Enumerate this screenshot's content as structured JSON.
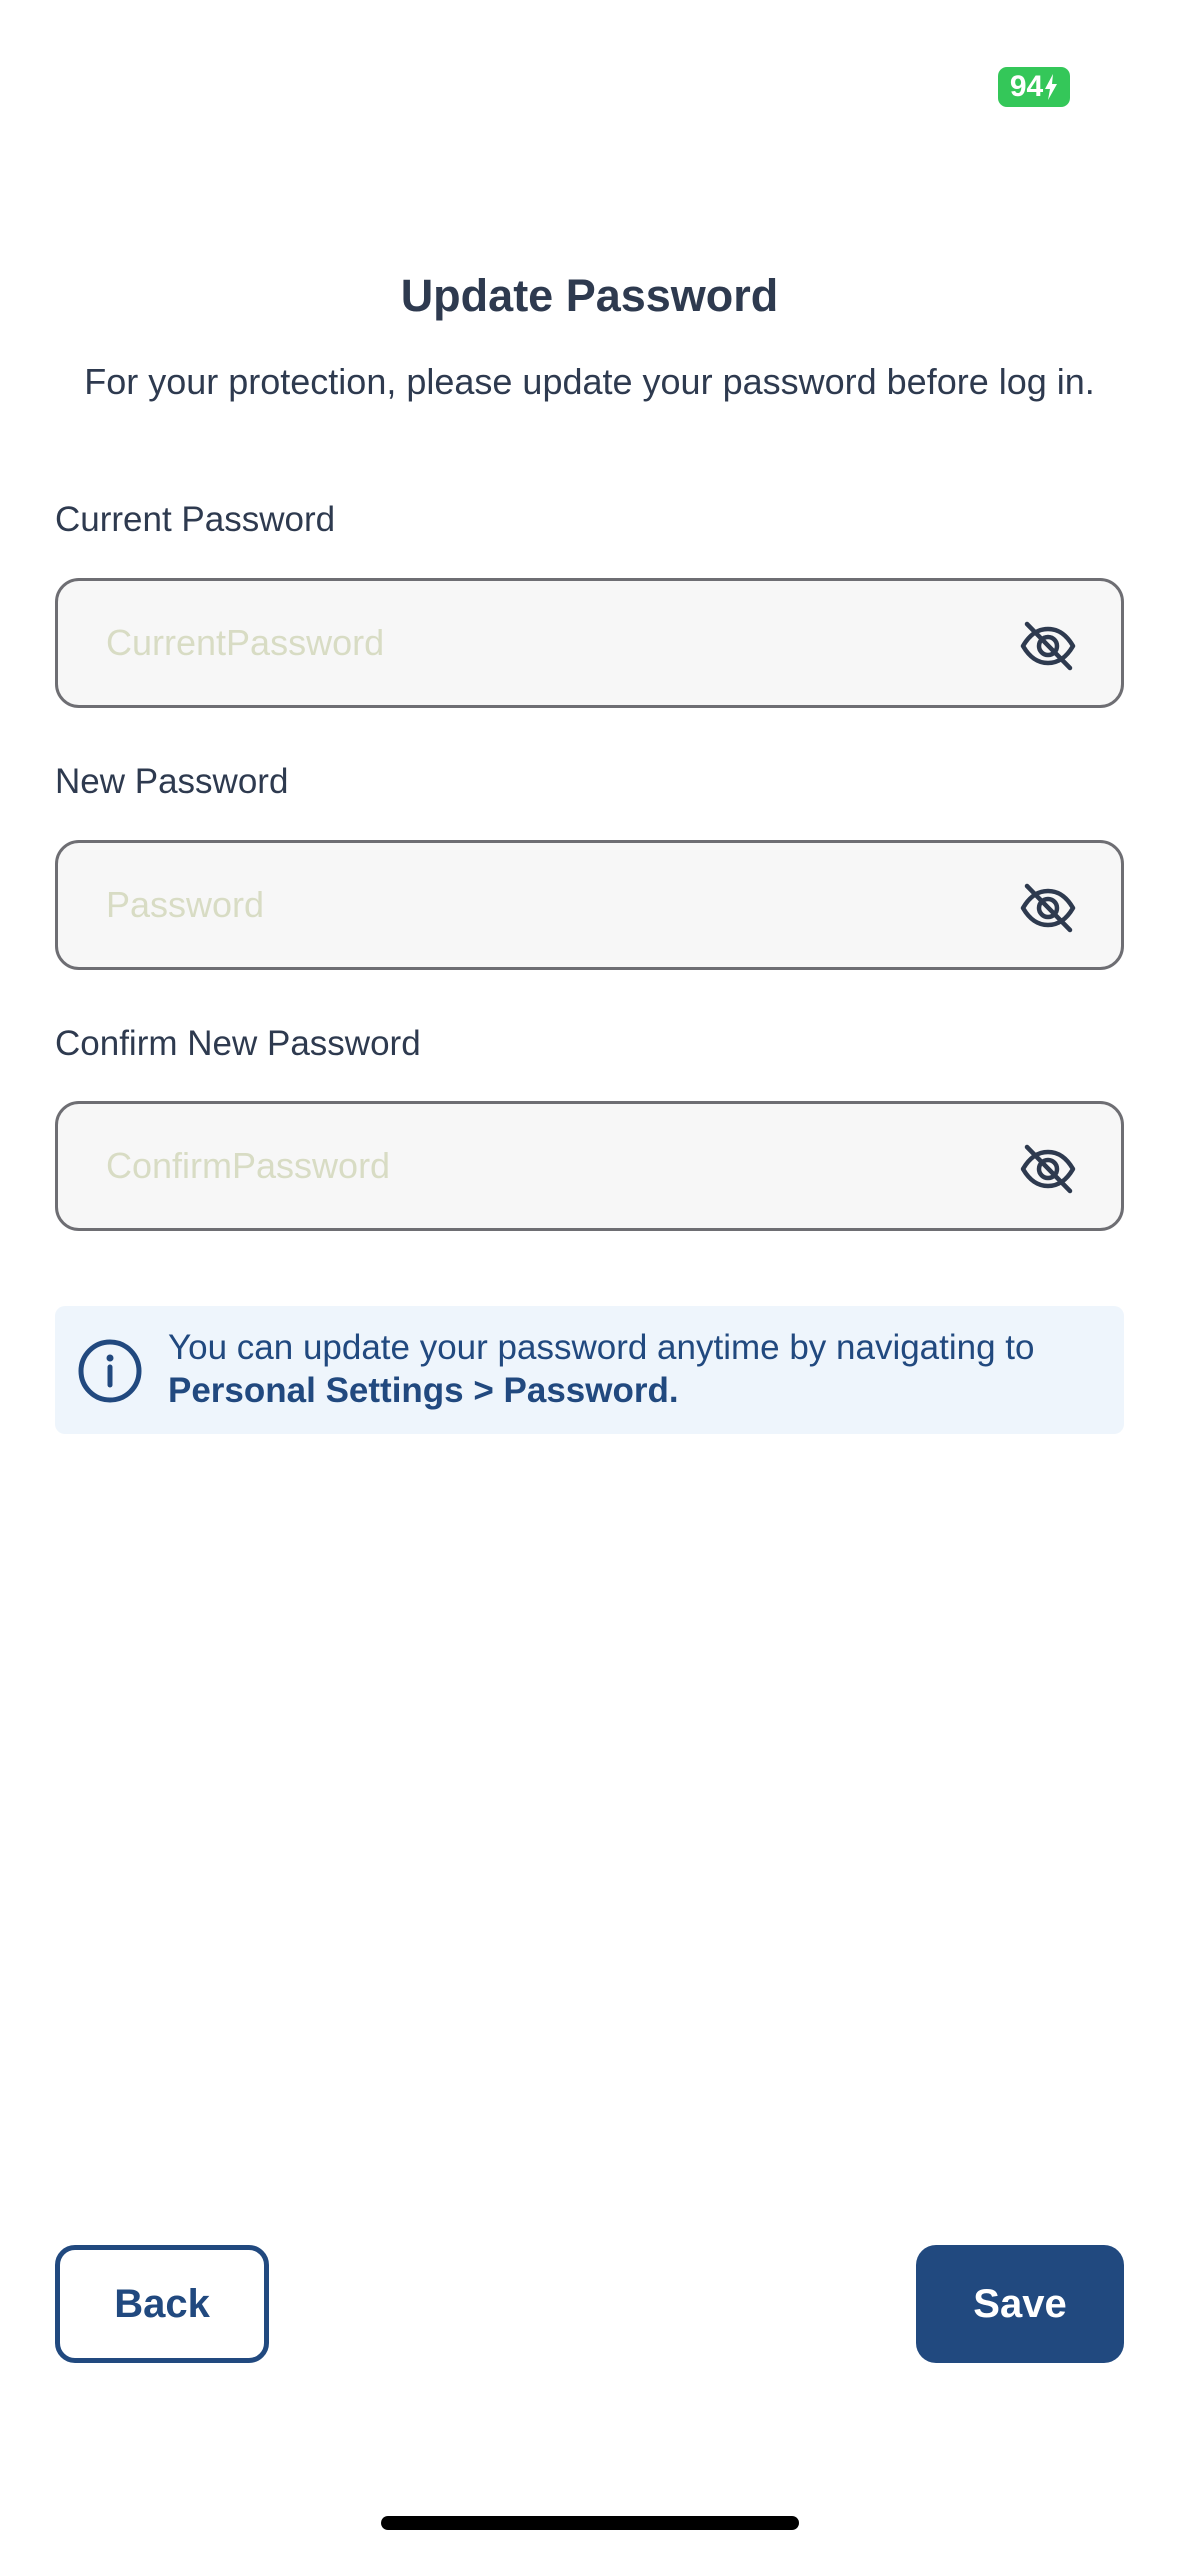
{
  "status_bar": {
    "battery_level": "94"
  },
  "header": {
    "title": "Update Password",
    "subtitle": "For your protection, please update your password before log in."
  },
  "form": {
    "current_password": {
      "label": "Current Password",
      "value": "",
      "placeholder": "CurrentPassword",
      "toggle_icon": "eye-off-icon"
    },
    "new_password": {
      "label": "New Password",
      "value": "",
      "placeholder": "Password",
      "toggle_icon": "eye-off-icon"
    },
    "confirm_password": {
      "label": "Confirm New Password",
      "value": "",
      "placeholder": "ConfirmPassword",
      "toggle_icon": "eye-off-icon"
    }
  },
  "info": {
    "icon": "info-icon",
    "text_prefix": "You can update your password anytime by navigating to ",
    "text_bold": "Personal Settings > Password."
  },
  "actions": {
    "back_label": "Back",
    "save_label": "Save"
  },
  "colors": {
    "primary": "#21497f",
    "text": "#2e3a4f",
    "battery": "#34c759",
    "info_bg": "#eef5fc",
    "field_bg": "#f7f7f7",
    "placeholder": "#d8dcc4"
  }
}
